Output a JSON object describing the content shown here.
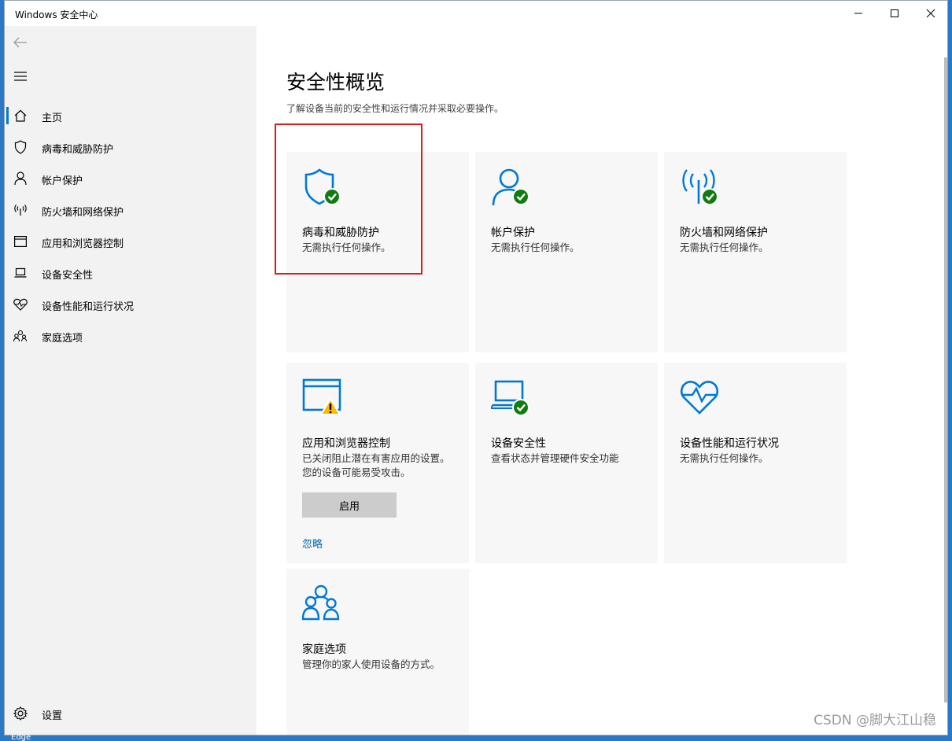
{
  "window": {
    "title": "Windows 安全中心"
  },
  "sidebar": {
    "items": [
      {
        "label": "主页",
        "icon": "home-icon"
      },
      {
        "label": "病毒和威胁防护",
        "icon": "shield-icon"
      },
      {
        "label": "帐户保护",
        "icon": "person-icon"
      },
      {
        "label": "防火墙和网络保护",
        "icon": "antenna-icon"
      },
      {
        "label": "应用和浏览器控制",
        "icon": "browser-window-icon"
      },
      {
        "label": "设备安全性",
        "icon": "laptop-icon"
      },
      {
        "label": "设备性能和运行状况",
        "icon": "heart-icon"
      },
      {
        "label": "家庭选项",
        "icon": "family-icon"
      }
    ],
    "settings_label": "设置"
  },
  "main": {
    "title": "安全性概览",
    "subtitle": "了解设备当前的安全性和运行情况并采取必要操作。",
    "cards": [
      {
        "title": "病毒和威胁防护",
        "desc": "无需执行任何操作。",
        "status": "ok"
      },
      {
        "title": "帐户保护",
        "desc": "无需执行任何操作。",
        "status": "ok"
      },
      {
        "title": "防火墙和网络保护",
        "desc": "无需执行任何操作。",
        "status": "ok"
      },
      {
        "title": "应用和浏览器控制",
        "desc": "已关闭阻止潜在有害应用的设置。您的设备可能易受攻击。",
        "status": "warning",
        "button": "启用",
        "link": "忽略"
      },
      {
        "title": "设备安全性",
        "desc": "查看状态并管理硬件安全功能",
        "status": "ok"
      },
      {
        "title": "设备性能和运行状况",
        "desc": "无需执行任何操作。",
        "status": "none"
      },
      {
        "title": "家庭选项",
        "desc": "管理你的家人使用设备的方式。",
        "status": "none"
      }
    ]
  },
  "colors": {
    "accent": "#0078d7",
    "ok": "#107c10",
    "warning": "#ffb900",
    "highlight": "#e0191d"
  },
  "watermark": "CSDN @脚大江山稳",
  "taskbar_text": "Edge"
}
